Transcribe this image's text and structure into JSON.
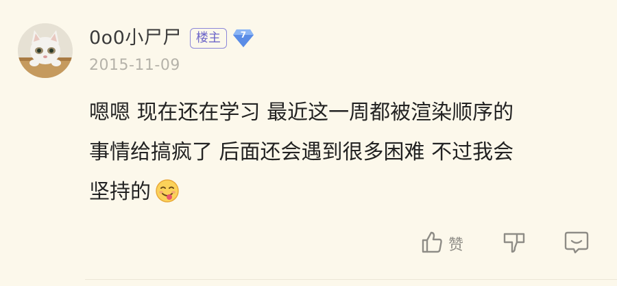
{
  "post": {
    "author": {
      "name": "0o0小尸尸",
      "role_badge": "楼主",
      "level": "7"
    },
    "date": "2015-11-09",
    "content_lines": [
      "嗯嗯 现在还在学习 最近这一周都被渲染顺序的",
      "事情给搞疯了 后面还会遇到很多困难 不过我会",
      "坚持的"
    ],
    "emoji": "yum-face-icon",
    "actions": {
      "like_label": "赞",
      "like_icon": "thumbs-up-icon",
      "dislike_icon": "thumbs-down-icon",
      "reply_icon": "comment-bubble-icon"
    }
  },
  "colors": {
    "background": "#fcf8eb",
    "badge": "#6b64c8",
    "gem": "#6e9ff0",
    "muted": "#b5b2a9"
  }
}
